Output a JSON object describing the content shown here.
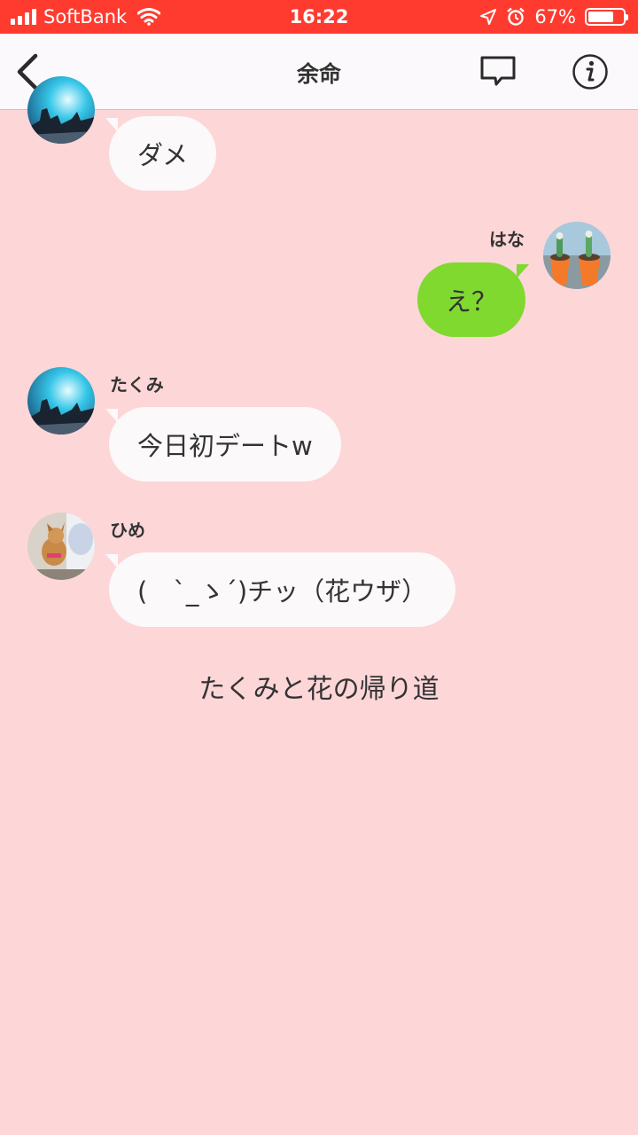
{
  "status_bar": {
    "carrier": "SoftBank",
    "time": "16:22",
    "battery_percent": "67%",
    "battery_level": 0.67
  },
  "header": {
    "title": "余命",
    "back_icon": "chevron-left-icon",
    "chat_icon": "speech-bubble-icon",
    "info_icon": "info-icon"
  },
  "messages": [
    {
      "sender": "",
      "text": "ダメ",
      "side": "left",
      "avatar": "concert-photo"
    },
    {
      "sender": "はな",
      "text": "え？",
      "side": "right",
      "avatar": "cactus-photo"
    },
    {
      "sender": "たくみ",
      "text": "今日初デートw",
      "side": "left",
      "avatar": "concert-photo"
    },
    {
      "sender": "ひめ",
      "text": "(　`_ゝ´)チッ（花ウザ）",
      "side": "left",
      "avatar": "dog-photo"
    }
  ],
  "narration": "たくみと花の帰り道",
  "colors": {
    "status_bar": "#ff3b30",
    "background": "#fdd6d8",
    "header": "#fbf9fb",
    "bubble_left": "#fbf9fa",
    "bubble_right": "#80d92f"
  }
}
